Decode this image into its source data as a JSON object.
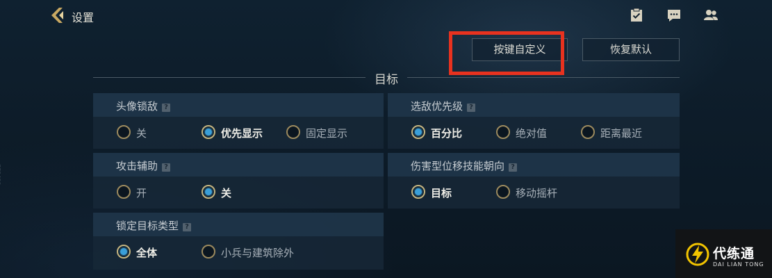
{
  "header": {
    "title": "设置",
    "icons": [
      "back-chevron-icon",
      "clipboard-check-icon",
      "chat-bubble-icon",
      "friends-icon"
    ]
  },
  "actions": {
    "custom_keys_label": "按键自定义",
    "reset_label": "恢复默认"
  },
  "section": {
    "title": "目标"
  },
  "panels": [
    {
      "id": "avatar-lock",
      "label": "头像锁敌",
      "options": [
        "关",
        "优先显示",
        "固定显示"
      ],
      "selected": 1
    },
    {
      "id": "enemy-priority",
      "label": "选敌优先级",
      "options": [
        "百分比",
        "绝对值",
        "距离最近"
      ],
      "selected": 0
    },
    {
      "id": "attack-assist",
      "label": "攻击辅助",
      "options": [
        "开",
        "关"
      ],
      "selected": 1
    },
    {
      "id": "damage-skill-direction",
      "label": "伤害型位移技能朝向",
      "options": [
        "目标",
        "移动摇杆"
      ],
      "selected": 0
    },
    {
      "id": "lock-target-type",
      "label": "锁定目标类型",
      "options": [
        "全体",
        "小兵与建筑除外"
      ],
      "selected": 0
    }
  ],
  "help_glyph": "?",
  "side_text": "773489",
  "watermark": {
    "name": "代练通",
    "subtitle": "DAI LIAN TONG"
  },
  "colors": {
    "highlight": "#e8321f",
    "radio_selected": "#3a9fd8",
    "radio_ring": "#c8b57e",
    "back_icon": "#c8a862"
  }
}
